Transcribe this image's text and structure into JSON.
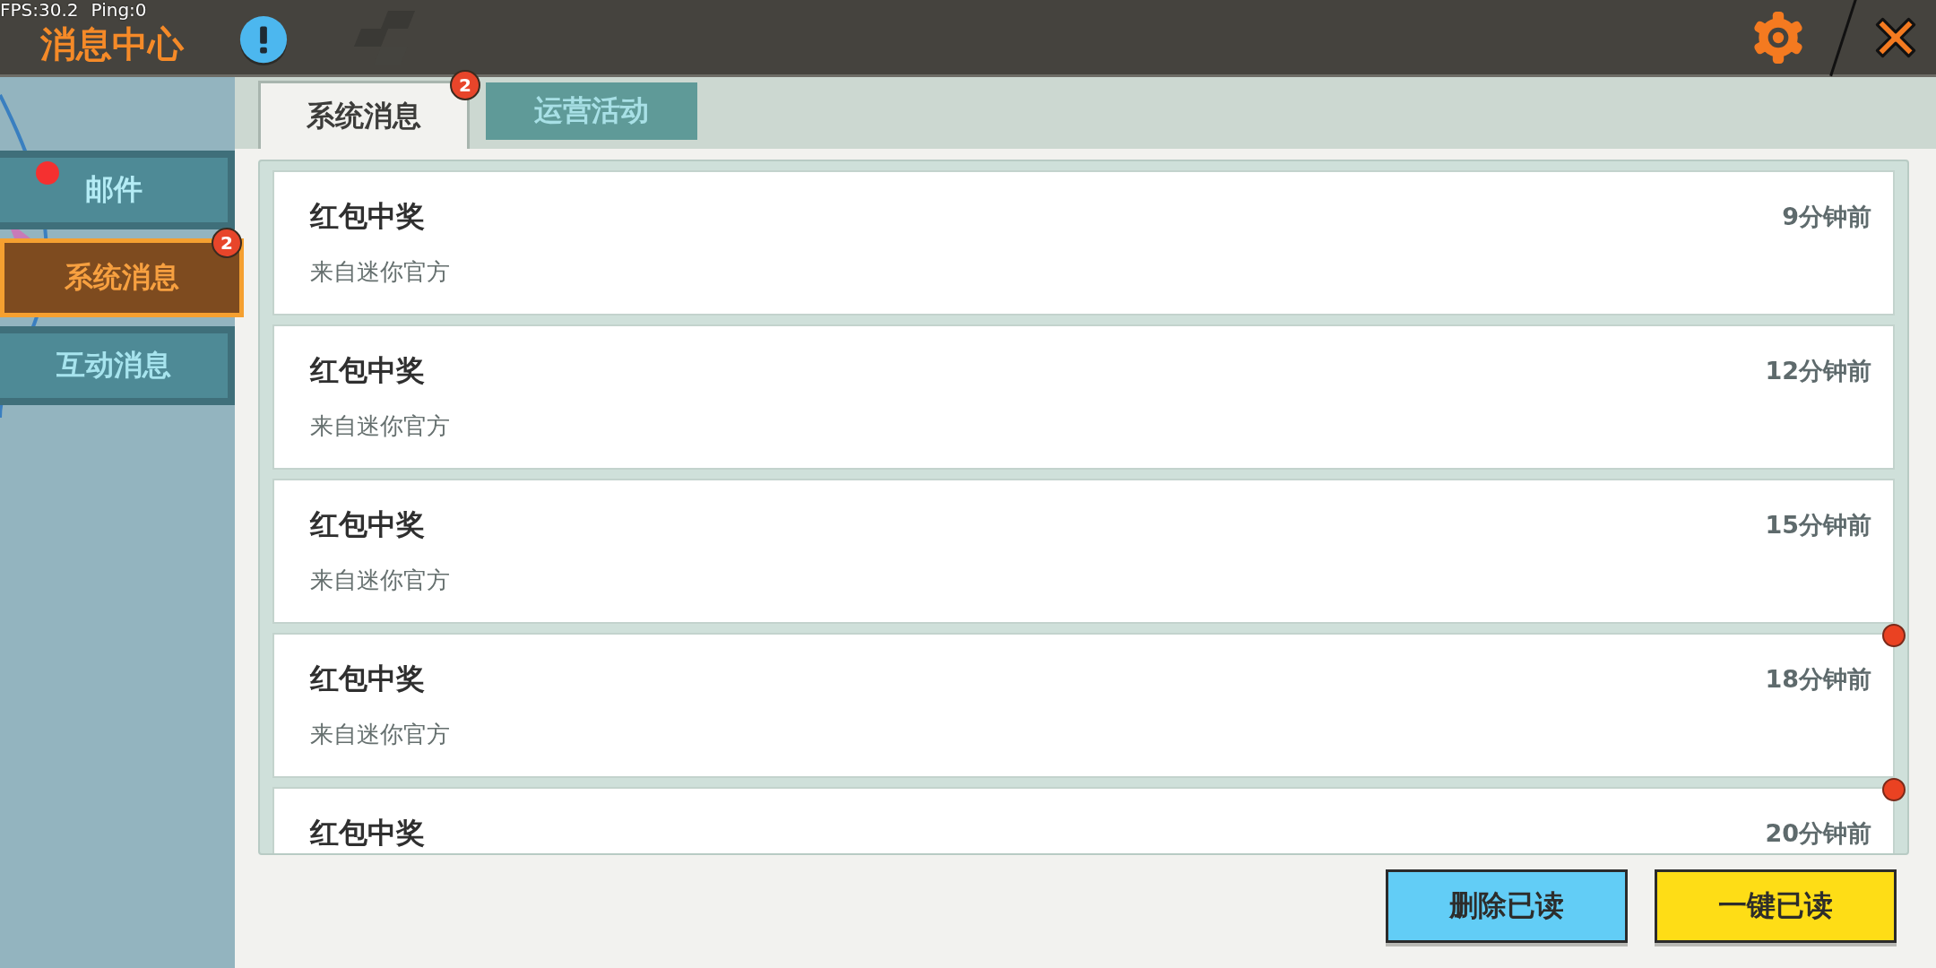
{
  "debug": {
    "fps": "FPS:30.2",
    "ping": "Ping:0"
  },
  "window": {
    "title": "消息中心"
  },
  "sidebar": {
    "items": [
      {
        "label": "邮件",
        "selected": false,
        "unread": true
      },
      {
        "label": "系统消息",
        "selected": true,
        "unread": false,
        "badge": "2"
      },
      {
        "label": "互动消息",
        "selected": false,
        "unread": false
      }
    ]
  },
  "tabs": [
    {
      "label": "系统消息",
      "selected": true,
      "badge": "2"
    },
    {
      "label": "运营活动",
      "selected": false
    }
  ],
  "messages": [
    {
      "title": "红包中奖",
      "time": "9分钟前",
      "source": "来自迷你官方",
      "unread": false
    },
    {
      "title": "红包中奖",
      "time": "12分钟前",
      "source": "来自迷你官方",
      "unread": false
    },
    {
      "title": "红包中奖",
      "time": "15分钟前",
      "source": "来自迷你官方",
      "unread": false
    },
    {
      "title": "红包中奖",
      "time": "18分钟前",
      "source": "来自迷你官方",
      "unread": true
    },
    {
      "title": "红包中奖",
      "time": "20分钟前",
      "unread": true
    }
  ],
  "buttons": [
    {
      "label": "删除已读",
      "kind": "secondary"
    },
    {
      "label": "一键已读",
      "kind": "primary"
    }
  ]
}
